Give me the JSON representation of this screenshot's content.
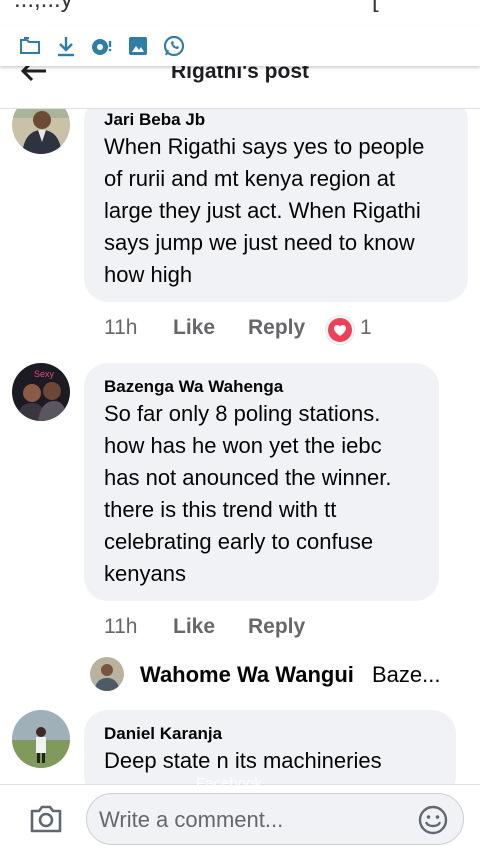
{
  "status_bar": {
    "partial_text": "...,...y",
    "partial_right": "["
  },
  "notification_icons": [
    "sd-card-icon",
    "download-icon",
    "data-saver-icon",
    "image-icon",
    "whatsapp-icon"
  ],
  "header": {
    "title": "Rigathi's post",
    "back_icon": "back-arrow-icon"
  },
  "comments": [
    {
      "author": "Jari Beba Jb",
      "text": "When Rigathi says yes to people\nof rurii and mt kenya region at\nlarge they just act. When Rigathi\nsays jump we just need to know\nhow high",
      "time": "11h",
      "like_label": "Like",
      "reply_label": "Reply",
      "reaction_count": "1",
      "reaction_icon": "love-reaction-icon"
    },
    {
      "author": "Bazenga Wa Wahenga",
      "text": "So far only 8 poling stations.\nhow has he won yet the iebc\nhas not anounced the winner.\nthere is this trend with tt\ncelebrating early to confuse\nkenyans",
      "time": "11h",
      "like_label": "Like",
      "reply_label": "Reply",
      "reply_preview": {
        "author": "Wahome Wa Wangui",
        "snippet": "Baze..."
      }
    },
    {
      "author": "Daniel Karanja",
      "text": "Deep state n its machineries"
    }
  ],
  "composer": {
    "placeholder": "Write a comment...",
    "ghost_text": "Facebook"
  },
  "colors": {
    "bubble": "#f0f2f5",
    "meta_text": "#65676b",
    "love": "#f33e58",
    "accent": "#1a73a8"
  }
}
